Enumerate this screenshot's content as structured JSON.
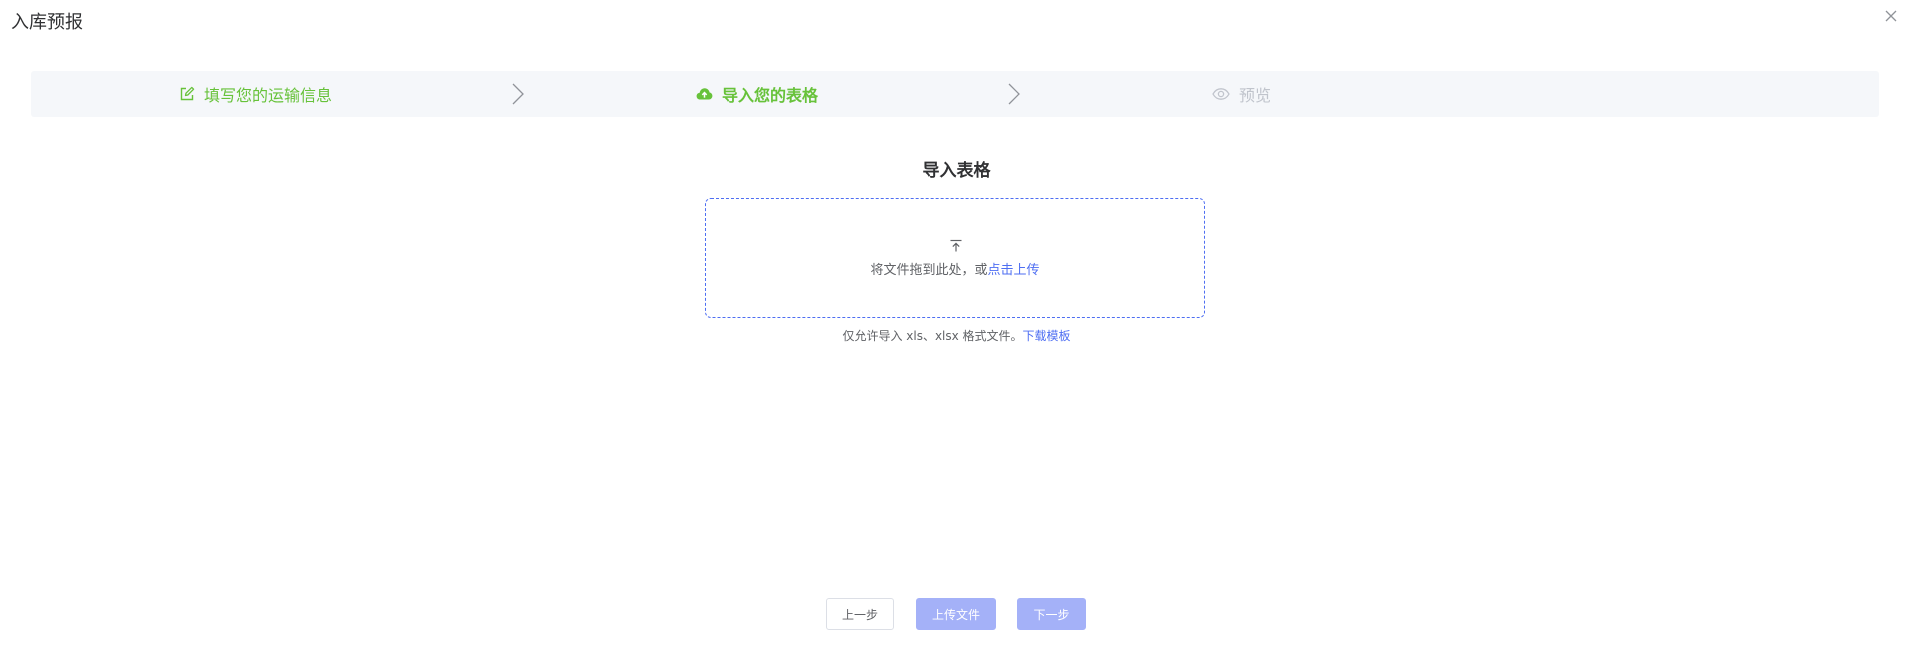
{
  "dialog": {
    "title": "入库预报"
  },
  "steps": [
    {
      "label": "填写您的运输信息",
      "icon": "edit-icon",
      "state": "done"
    },
    {
      "label": "导入您的表格",
      "icon": "cloud-upload-icon",
      "state": "active"
    },
    {
      "label": "预览",
      "icon": "eye-icon",
      "state": "pending"
    }
  ],
  "upload": {
    "section_title": "导入表格",
    "drag_text": "将文件拖到此处，或",
    "click_text": "点击上传",
    "tip_text": "仅允许导入 xls、xlsx 格式文件。",
    "template_link": "下载模板"
  },
  "footer": {
    "prev_label": "上一步",
    "upload_label": "上传文件",
    "next_label": "下一步"
  },
  "colors": {
    "accent": "#4e6ef2",
    "success": "#67c23a",
    "disabled": "#c0c4cc",
    "button_disabled": "#a4b1f8"
  }
}
